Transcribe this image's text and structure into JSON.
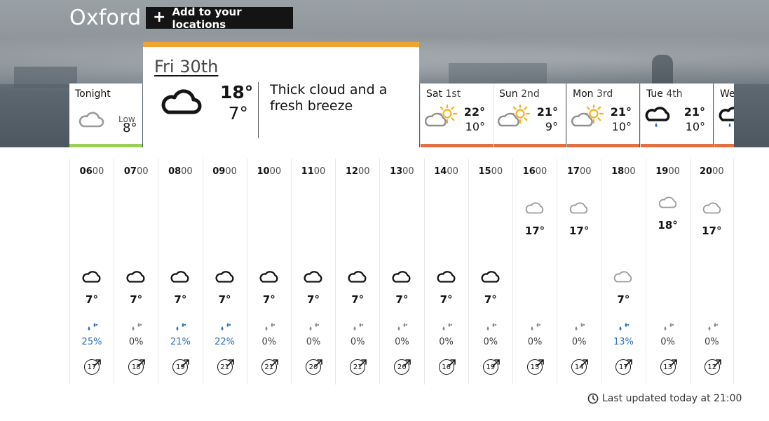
{
  "location": {
    "name": "Oxford",
    "add_label": "Add to your locations"
  },
  "tonight": {
    "label": "Tonight",
    "low_label": "Low",
    "low_value": "8°",
    "bar_color": "#9ccf55",
    "icon": "cloud-icon"
  },
  "selected_day": {
    "day": "Fri",
    "date": "30th",
    "high": "18°",
    "low": "7°",
    "description": "Thick cloud and a fresh breeze",
    "icon": "thick-cloud-icon",
    "top_bar_color": "#f0a232"
  },
  "days": [
    {
      "day": "Sat",
      "date": "1st",
      "high": "22°",
      "low": "10°",
      "icon": "sun-cloud-icon",
      "bar_color": "#e27043"
    },
    {
      "day": "Sun",
      "date": "2nd",
      "high": "21°",
      "low": "9°",
      "icon": "sun-cloud-icon",
      "bar_color": "#e27043"
    },
    {
      "day": "Mon",
      "date": "3rd",
      "high": "21°",
      "low": "10°",
      "icon": "sun-cloud-icon",
      "bar_color": "#e27043"
    },
    {
      "day": "Tue",
      "date": "4th",
      "high": "21°",
      "low": "10°",
      "icon": "light-rain-icon",
      "bar_color": "#e27043"
    },
    {
      "day": "We",
      "date": "",
      "high": "",
      "low": "",
      "icon": "light-rain-icon",
      "bar_color": "#e27043"
    }
  ],
  "hours": [
    {
      "h": "06",
      "m": "00",
      "temp": "7°",
      "icon": "cloud-icon",
      "style": "dark",
      "rain": "25%",
      "rain_blue": true,
      "wind": "17"
    },
    {
      "h": "07",
      "m": "00",
      "temp": "7°",
      "icon": "cloud-icon",
      "style": "dark",
      "rain": "0%",
      "rain_blue": false,
      "wind": "18"
    },
    {
      "h": "08",
      "m": "00",
      "temp": "7°",
      "icon": "cloud-icon",
      "style": "dark",
      "rain": "21%",
      "rain_blue": true,
      "wind": "19"
    },
    {
      "h": "09",
      "m": "00",
      "temp": "7°",
      "icon": "cloud-icon",
      "style": "dark",
      "rain": "22%",
      "rain_blue": true,
      "wind": "21"
    },
    {
      "h": "10",
      "m": "00",
      "temp": "7°",
      "icon": "cloud-icon",
      "style": "dark",
      "rain": "0%",
      "rain_blue": false,
      "wind": "21"
    },
    {
      "h": "11",
      "m": "00",
      "temp": "7°",
      "icon": "cloud-icon",
      "style": "dark",
      "rain": "0%",
      "rain_blue": false,
      "wind": "20"
    },
    {
      "h": "12",
      "m": "00",
      "temp": "7°",
      "icon": "cloud-icon",
      "style": "dark",
      "rain": "0%",
      "rain_blue": false,
      "wind": "21"
    },
    {
      "h": "13",
      "m": "00",
      "temp": "7°",
      "icon": "cloud-icon",
      "style": "dark",
      "rain": "0%",
      "rain_blue": false,
      "wind": "20"
    },
    {
      "h": "14",
      "m": "00",
      "temp": "7°",
      "icon": "cloud-icon",
      "style": "dark",
      "rain": "0%",
      "rain_blue": false,
      "wind": "16"
    },
    {
      "h": "15",
      "m": "00",
      "temp": "7°",
      "icon": "cloud-icon",
      "style": "dark",
      "rain": "0%",
      "rain_blue": false,
      "wind": "19"
    },
    {
      "h": "16",
      "m": "00",
      "temp": "17°",
      "icon": "cloud-icon",
      "style": "light",
      "rain": "0%",
      "rain_blue": false,
      "wind": "15"
    },
    {
      "h": "17",
      "m": "00",
      "temp": "17°",
      "icon": "cloud-icon",
      "style": "light",
      "rain": "0%",
      "rain_blue": false,
      "wind": "14"
    },
    {
      "h": "18",
      "m": "00",
      "temp": "7°",
      "icon": "cloud-icon",
      "style": "light",
      "rain": "13%",
      "rain_blue": true,
      "wind": "17"
    },
    {
      "h": "19",
      "m": "00",
      "temp": "18°",
      "icon": "cloud-icon",
      "style": "light",
      "rain": "0%",
      "rain_blue": false,
      "wind": "13"
    },
    {
      "h": "20",
      "m": "00",
      "temp": "17°",
      "icon": "cloud-icon",
      "style": "light",
      "rain": "0%",
      "rain_blue": false,
      "wind": "12"
    }
  ],
  "hour_temp_levels": [
    7,
    7,
    7,
    7,
    7,
    7,
    7,
    7,
    7,
    7,
    17,
    17,
    7,
    18,
    17
  ],
  "last_updated": "Last updated today at 21:00",
  "colors": {
    "rain_blue": "#2f6fb6",
    "rain_grey": "#8a8a8a",
    "light_icon": "#9a9a9a"
  }
}
